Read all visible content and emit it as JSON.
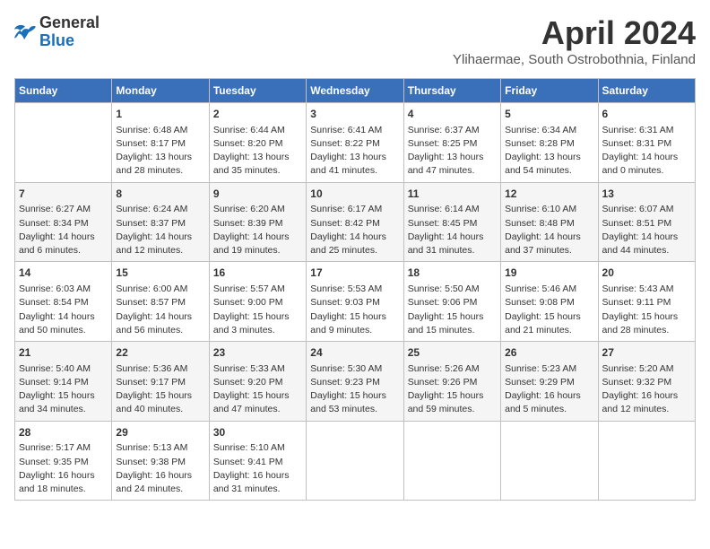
{
  "header": {
    "logo_general": "General",
    "logo_blue": "Blue",
    "month_title": "April 2024",
    "subtitle": "Ylihaermae, South Ostrobothnia, Finland"
  },
  "calendar": {
    "weekdays": [
      "Sunday",
      "Monday",
      "Tuesday",
      "Wednesday",
      "Thursday",
      "Friday",
      "Saturday"
    ],
    "weeks": [
      [
        {
          "day": "",
          "info": ""
        },
        {
          "day": "1",
          "info": "Sunrise: 6:48 AM\nSunset: 8:17 PM\nDaylight: 13 hours\nand 28 minutes."
        },
        {
          "day": "2",
          "info": "Sunrise: 6:44 AM\nSunset: 8:20 PM\nDaylight: 13 hours\nand 35 minutes."
        },
        {
          "day": "3",
          "info": "Sunrise: 6:41 AM\nSunset: 8:22 PM\nDaylight: 13 hours\nand 41 minutes."
        },
        {
          "day": "4",
          "info": "Sunrise: 6:37 AM\nSunset: 8:25 PM\nDaylight: 13 hours\nand 47 minutes."
        },
        {
          "day": "5",
          "info": "Sunrise: 6:34 AM\nSunset: 8:28 PM\nDaylight: 13 hours\nand 54 minutes."
        },
        {
          "day": "6",
          "info": "Sunrise: 6:31 AM\nSunset: 8:31 PM\nDaylight: 14 hours\nand 0 minutes."
        }
      ],
      [
        {
          "day": "7",
          "info": "Sunrise: 6:27 AM\nSunset: 8:34 PM\nDaylight: 14 hours\nand 6 minutes."
        },
        {
          "day": "8",
          "info": "Sunrise: 6:24 AM\nSunset: 8:37 PM\nDaylight: 14 hours\nand 12 minutes."
        },
        {
          "day": "9",
          "info": "Sunrise: 6:20 AM\nSunset: 8:39 PM\nDaylight: 14 hours\nand 19 minutes."
        },
        {
          "day": "10",
          "info": "Sunrise: 6:17 AM\nSunset: 8:42 PM\nDaylight: 14 hours\nand 25 minutes."
        },
        {
          "day": "11",
          "info": "Sunrise: 6:14 AM\nSunset: 8:45 PM\nDaylight: 14 hours\nand 31 minutes."
        },
        {
          "day": "12",
          "info": "Sunrise: 6:10 AM\nSunset: 8:48 PM\nDaylight: 14 hours\nand 37 minutes."
        },
        {
          "day": "13",
          "info": "Sunrise: 6:07 AM\nSunset: 8:51 PM\nDaylight: 14 hours\nand 44 minutes."
        }
      ],
      [
        {
          "day": "14",
          "info": "Sunrise: 6:03 AM\nSunset: 8:54 PM\nDaylight: 14 hours\nand 50 minutes."
        },
        {
          "day": "15",
          "info": "Sunrise: 6:00 AM\nSunset: 8:57 PM\nDaylight: 14 hours\nand 56 minutes."
        },
        {
          "day": "16",
          "info": "Sunrise: 5:57 AM\nSunset: 9:00 PM\nDaylight: 15 hours\nand 3 minutes."
        },
        {
          "day": "17",
          "info": "Sunrise: 5:53 AM\nSunset: 9:03 PM\nDaylight: 15 hours\nand 9 minutes."
        },
        {
          "day": "18",
          "info": "Sunrise: 5:50 AM\nSunset: 9:06 PM\nDaylight: 15 hours\nand 15 minutes."
        },
        {
          "day": "19",
          "info": "Sunrise: 5:46 AM\nSunset: 9:08 PM\nDaylight: 15 hours\nand 21 minutes."
        },
        {
          "day": "20",
          "info": "Sunrise: 5:43 AM\nSunset: 9:11 PM\nDaylight: 15 hours\nand 28 minutes."
        }
      ],
      [
        {
          "day": "21",
          "info": "Sunrise: 5:40 AM\nSunset: 9:14 PM\nDaylight: 15 hours\nand 34 minutes."
        },
        {
          "day": "22",
          "info": "Sunrise: 5:36 AM\nSunset: 9:17 PM\nDaylight: 15 hours\nand 40 minutes."
        },
        {
          "day": "23",
          "info": "Sunrise: 5:33 AM\nSunset: 9:20 PM\nDaylight: 15 hours\nand 47 minutes."
        },
        {
          "day": "24",
          "info": "Sunrise: 5:30 AM\nSunset: 9:23 PM\nDaylight: 15 hours\nand 53 minutes."
        },
        {
          "day": "25",
          "info": "Sunrise: 5:26 AM\nSunset: 9:26 PM\nDaylight: 15 hours\nand 59 minutes."
        },
        {
          "day": "26",
          "info": "Sunrise: 5:23 AM\nSunset: 9:29 PM\nDaylight: 16 hours\nand 5 minutes."
        },
        {
          "day": "27",
          "info": "Sunrise: 5:20 AM\nSunset: 9:32 PM\nDaylight: 16 hours\nand 12 minutes."
        }
      ],
      [
        {
          "day": "28",
          "info": "Sunrise: 5:17 AM\nSunset: 9:35 PM\nDaylight: 16 hours\nand 18 minutes."
        },
        {
          "day": "29",
          "info": "Sunrise: 5:13 AM\nSunset: 9:38 PM\nDaylight: 16 hours\nand 24 minutes."
        },
        {
          "day": "30",
          "info": "Sunrise: 5:10 AM\nSunset: 9:41 PM\nDaylight: 16 hours\nand 31 minutes."
        },
        {
          "day": "",
          "info": ""
        },
        {
          "day": "",
          "info": ""
        },
        {
          "day": "",
          "info": ""
        },
        {
          "day": "",
          "info": ""
        }
      ]
    ]
  }
}
